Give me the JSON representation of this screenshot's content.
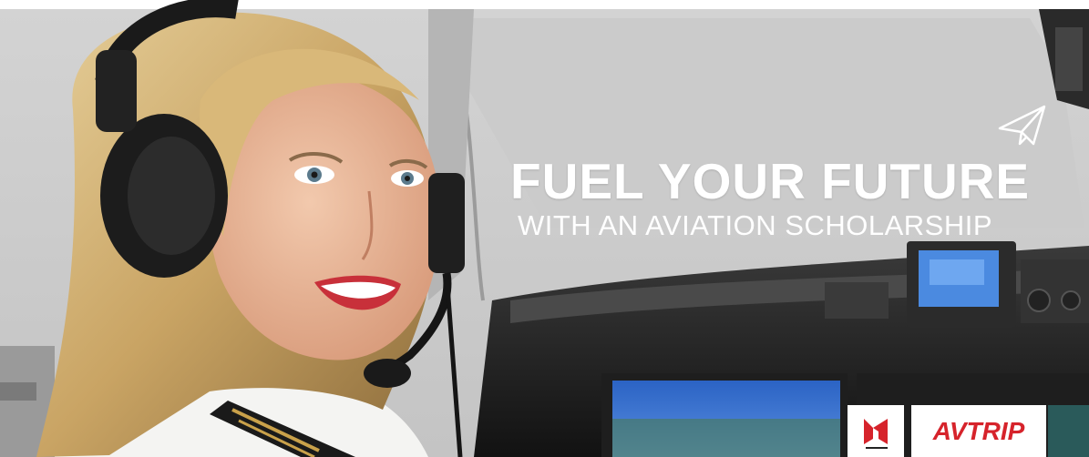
{
  "banner": {
    "headline": "FUEL YOUR FUTURE",
    "subheadline": "WITH AN AVIATION SCHOLARSHIP",
    "plane_icon": "paper-plane-icon",
    "logos": {
      "left_icon": "chevron-logo-icon",
      "right_text": "AVTRIP"
    },
    "colors": {
      "headline": "#ffffff",
      "brand_red": "#d6232b",
      "screen_blue": "#2f6fd0"
    }
  }
}
